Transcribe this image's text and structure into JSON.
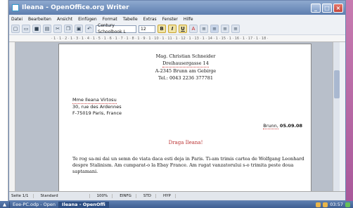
{
  "window": {
    "title": "Ileana - OpenOffice.org Writer"
  },
  "menu": [
    "Datei",
    "Bearbeiten",
    "Ansicht",
    "Einfügen",
    "Format",
    "Tabelle",
    "Extras",
    "Fenster",
    "Hilfe"
  ],
  "toolbar": {
    "font_name": "Century Schoolbook L",
    "font_size": "12"
  },
  "ruler": "· 1 · 1 · 2 · 1 · 3 · 1 · 4 · 1 · 5 · 1 · 6 · 1 · 7 · 1 · 8 · 1 · 9 · 1 · 10 · 1 · 11 · 1 · 12 · 1 · 13 · 1 · 14 · 1 · 15 · 1 · 16 · 1 · 17 · 1 · 18 ·",
  "doc": {
    "header": [
      "Mag. Christian Schneider",
      "Dreihausergasse 14",
      "A-2345 Brunn am Gebirge",
      "Tel.: 0043 2236 377781"
    ],
    "recipient": [
      "Mme Ileana Virtosu",
      "30, rue des Ardennes",
      "F-75019 Paris, France"
    ],
    "date_place": "Brunn,",
    "date_value": "05.09.08",
    "greeting": "Draga Ileana!",
    "body": "Te rog sa-mi dai un semn de viata daca esti deja in Paris. Ti-am trimis cartea de Wolfgang Leonhard despre Stalinism. Am cumparat-o la Ebay France. Am rugat vanzatorului s-o trimita peste doua saptamani."
  },
  "status": {
    "page": "Seite 1/1",
    "style": "Standard",
    "zoom": "100%",
    "mode": "EINFG",
    "std": "STD",
    "hyp": "HYP"
  },
  "taskbar": {
    "item1": "Eee-PC.odp - Open",
    "item2": "Ileana - OpenOffi",
    "clock": "03:57"
  }
}
